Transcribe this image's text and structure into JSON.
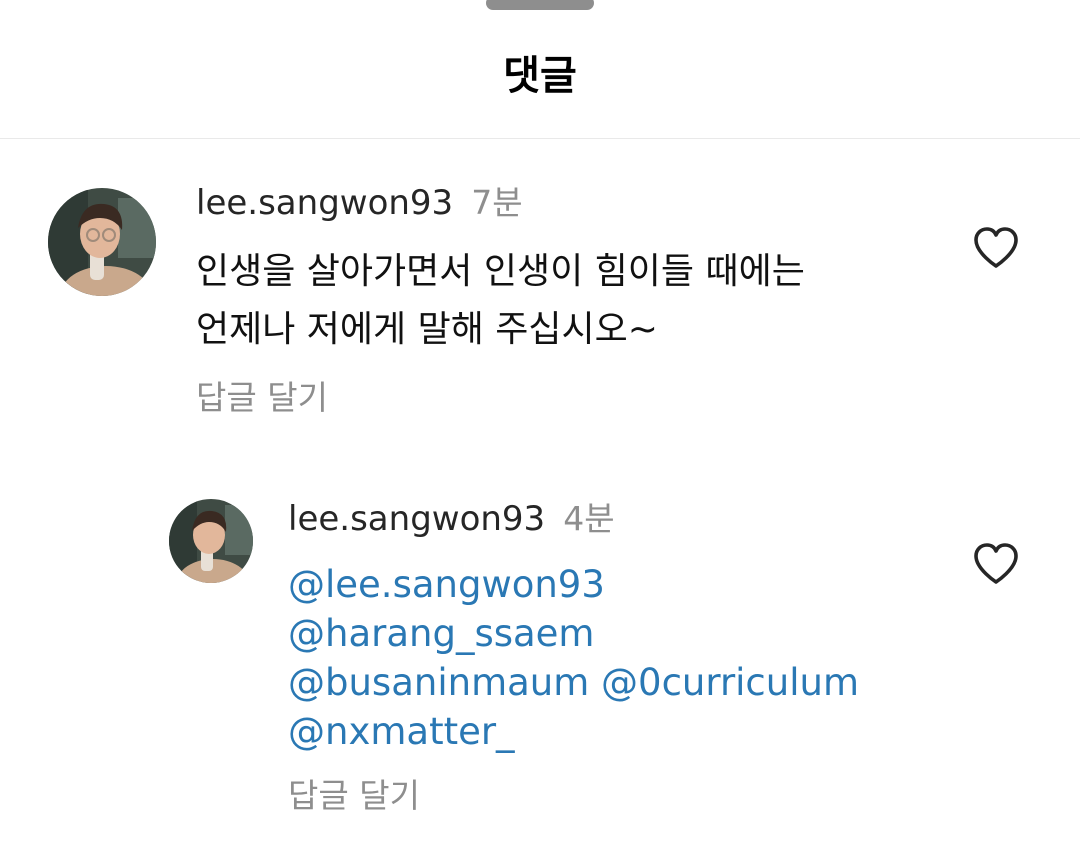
{
  "header": {
    "title": "댓글"
  },
  "comments": [
    {
      "username": "lee.sangwon93",
      "time": "7분",
      "text_lines": [
        "인생을 살아가면서 인생이 힘이들 때에는",
        "언제나 저에게 말해 주십시오~"
      ],
      "reply_label": "답글 달기",
      "like_icon": "heart-outline-icon"
    },
    {
      "username": "lee.sangwon93",
      "time": "4분",
      "mention_lines": [
        [
          "@lee.sangwon93"
        ],
        [
          "@harang_ssaem"
        ],
        [
          "@busaninmaum",
          "@0curriculum"
        ],
        [
          "@nxmatter_"
        ]
      ],
      "reply_label": "답글 달기",
      "like_icon": "heart-outline-icon"
    }
  ],
  "colors": {
    "mention": "#2a78b4",
    "secondary_text": "#8e8e8e",
    "divider": "#e9e9e9",
    "handle": "#8e8e8e"
  }
}
